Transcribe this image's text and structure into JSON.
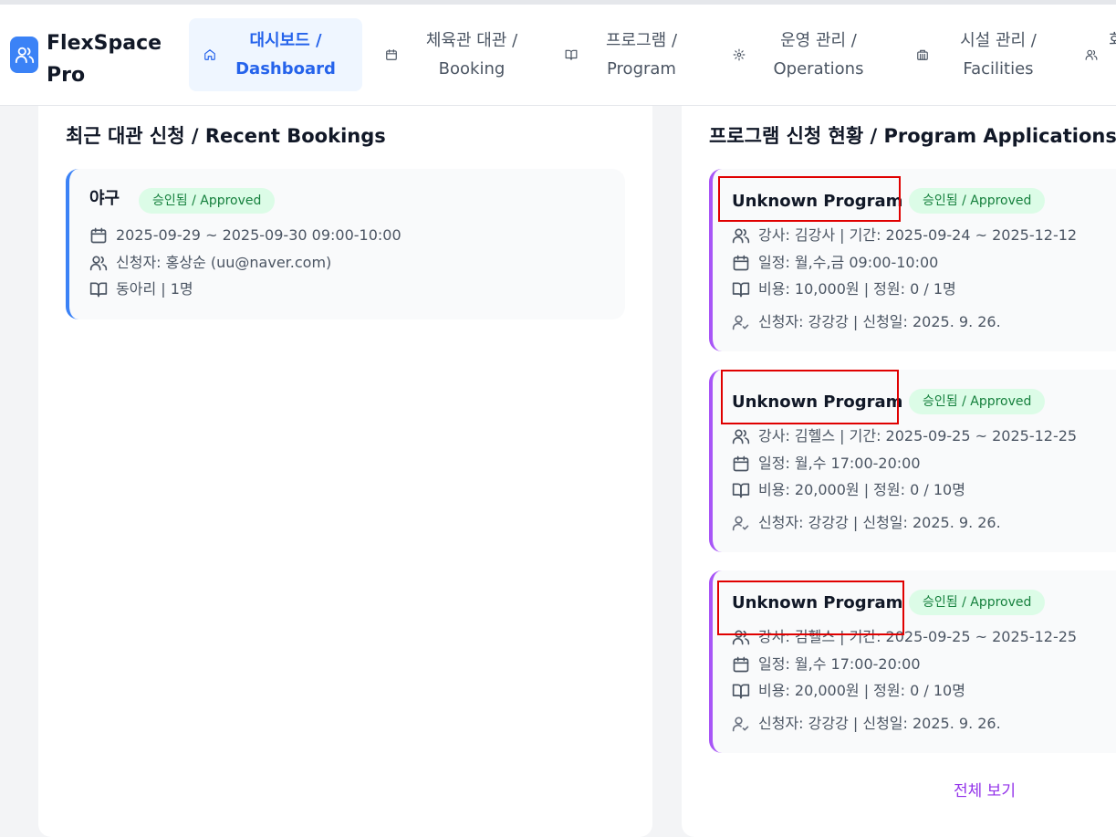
{
  "brand": {
    "logo_icon": "users-icon",
    "name": "FlexSpace Pro",
    "accent": "#3b82f6"
  },
  "nav": [
    {
      "label": "대시보드 /\nDashboard",
      "icon": "home-icon",
      "active": true
    },
    {
      "label": "체육관 대관 /\nBooking",
      "icon": "calendar-icon",
      "active": false
    },
    {
      "label": "프로그램 /\nProgram",
      "icon": "book-icon",
      "active": false
    },
    {
      "label": "운영 관리 /\nOperations",
      "icon": "gear-icon",
      "active": false
    },
    {
      "label": "시설 관리 /\nFacilities",
      "icon": "building-icon",
      "active": false
    },
    {
      "label": "회",
      "icon": "users-icon",
      "active": false
    }
  ],
  "recent_bookings": {
    "title": "최근 대관 신청 / Recent Bookings",
    "items": [
      {
        "sport": "야구",
        "status": "승인됨 / Approved",
        "date_time": "2025-09-29 ~ 2025-09-30 09:00-10:00",
        "applicant": "신청자: 홍상순 (uu@naver.com)",
        "group": "동아리 | 1명"
      }
    ]
  },
  "program_applications": {
    "title": "프로그램 신청 현황 / Program Applications",
    "items": [
      {
        "name": "Unknown Program",
        "status": "승인됨 / Approved",
        "instructor_period": "강사: 김강사 | 기간: 2025-09-24 ~ 2025-12-12",
        "schedule": "일정: 월,수,금 09:00-10:00",
        "fee_capacity": "비용: 10,000원 | 정원: 0 / 1명",
        "applicant_date": "신청자: 강강강 | 신청일: 2025. 9. 26."
      },
      {
        "name": "Unknown Program",
        "status": "승인됨 / Approved",
        "instructor_period": "강사: 김헬스 | 기간: 2025-09-25 ~ 2025-12-25",
        "schedule": "일정: 월,수 17:00-20:00",
        "fee_capacity": "비용: 20,000원 | 정원: 0 / 10명",
        "applicant_date": "신청자: 강강강 | 신청일: 2025. 9. 26."
      },
      {
        "name": "Unknown Program",
        "status": "승인됨 / Approved",
        "instructor_period": "강사: 김헬스 | 기간: 2025-09-25 ~ 2025-12-25",
        "schedule": "일정: 월,수 17:00-20:00",
        "fee_capacity": "비용: 20,000원 | 정원: 0 / 10명",
        "applicant_date": "신청자: 강강강 | 신청일: 2025. 9. 26."
      }
    ],
    "view_all": "전체 보기"
  },
  "colors": {
    "booking_border": "#3b82f6",
    "program_border": "#a855f7",
    "badge_bg": "#dcfce7",
    "badge_text": "#15803d",
    "highlight": "#e00000",
    "view_all": "#9333ea"
  }
}
